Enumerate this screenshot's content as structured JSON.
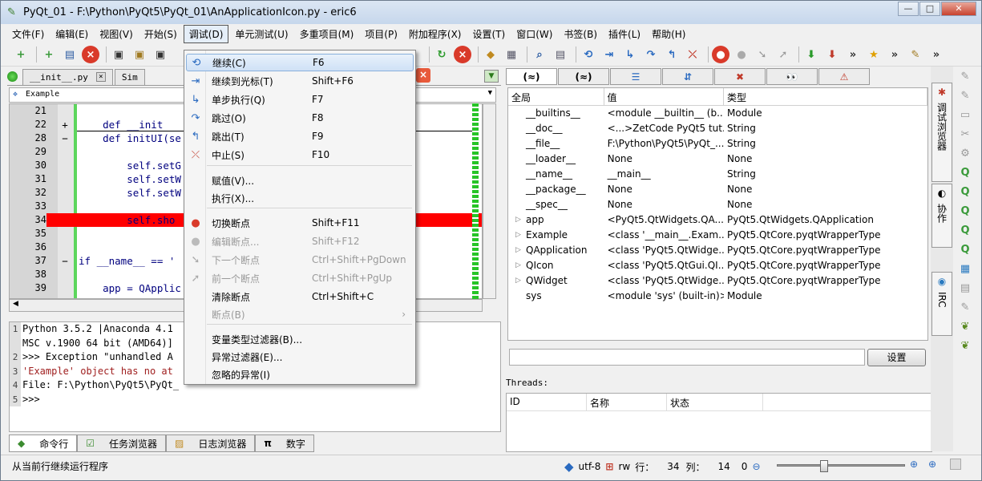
{
  "window": {
    "title": "PyQt_01 - F:\\Python\\PyQt5\\PyQt_01\\AnApplicationIcon.py - eric6",
    "min": "—",
    "max": "□",
    "close": "✕"
  },
  "menubar": [
    "文件(F)",
    "编辑(E)",
    "视图(V)",
    "开始(S)",
    "调试(D)",
    "单元测试(U)",
    "多重项目(M)",
    "项目(P)",
    "附加程序(X)",
    "设置(T)",
    "窗口(W)",
    "书签(B)",
    "插件(L)",
    "帮助(H)"
  ],
  "editor": {
    "tabs": [
      {
        "label": "__init__.py"
      },
      {
        "label": "Sim"
      }
    ],
    "class_combo": "Example",
    "lines": [
      {
        "n": "21",
        "fold": "",
        "text": ""
      },
      {
        "n": "22",
        "fold": "+",
        "text": "    def __init"
      },
      {
        "n": "28",
        "fold": "−",
        "text": "    def initUI(se"
      },
      {
        "n": "29",
        "fold": "",
        "text": ""
      },
      {
        "n": "30",
        "fold": "",
        "text": "        self.setG"
      },
      {
        "n": "31",
        "fold": "",
        "text": "        self.setW"
      },
      {
        "n": "32",
        "fold": "",
        "text": "        self.setW"
      },
      {
        "n": "33",
        "fold": "",
        "text": ""
      },
      {
        "n": "34",
        "fold": "",
        "text": "        self.sho"
      },
      {
        "n": "35",
        "fold": "",
        "text": ""
      },
      {
        "n": "36",
        "fold": "",
        "text": ""
      },
      {
        "n": "37",
        "fold": "−",
        "text": "if __name__ == '"
      },
      {
        "n": "38",
        "fold": "",
        "text": ""
      },
      {
        "n": "39",
        "fold": "",
        "text": "    app = QApplic"
      }
    ]
  },
  "shell": {
    "lines": [
      {
        "n": "1",
        "text": "Python 3.5.2 |Anaconda 4.1                      11:41:13) ["
      },
      {
        "n": "",
        "text": "MSC v.1900 64 bit (AMD64)]"
      },
      {
        "n": "2",
        "text": ">>> Exception \"unhandled A"
      },
      {
        "n": "3",
        "text": "'Example' object has no at"
      },
      {
        "n": "4",
        "text": "File: F:\\Python\\PyQt5\\PyQt_"
      },
      {
        "n": "5",
        "text": ">>>"
      }
    ]
  },
  "bottom_tabs": [
    "命令行",
    "任务浏览器",
    "日志浏览器",
    "数字"
  ],
  "debug_menu": {
    "items": [
      {
        "label": "继续(C)",
        "shortcut": "F6",
        "icon": "continue-icon",
        "glyph": "⟲",
        "disabled": false,
        "highlighted": true
      },
      {
        "label": "继续到光标(T)",
        "shortcut": "Shift+F6",
        "icon": "continue-to-cursor-icon",
        "glyph": "⇥",
        "disabled": false
      },
      {
        "label": "单步执行(Q)",
        "shortcut": "F7",
        "icon": "step-icon",
        "glyph": "↳",
        "disabled": false
      },
      {
        "label": "跳过(O)",
        "shortcut": "F8",
        "icon": "step-over-icon",
        "glyph": "↷",
        "disabled": false
      },
      {
        "label": "跳出(T)",
        "shortcut": "F9",
        "icon": "step-out-icon",
        "glyph": "↰",
        "disabled": false
      },
      {
        "label": "中止(S)",
        "shortcut": "F10",
        "icon": "stop-icon",
        "glyph": "⤫",
        "disabled": false
      },
      {
        "label": "赋值(V)...",
        "shortcut": "",
        "icon": "",
        "glyph": "",
        "disabled": false
      },
      {
        "label": "执行(X)...",
        "shortcut": "",
        "icon": "",
        "glyph": "",
        "disabled": false
      },
      {
        "label": "切换断点",
        "shortcut": "Shift+F11",
        "icon": "toggle-breakpoint-icon",
        "glyph": "●",
        "disabled": false
      },
      {
        "label": "编辑断点...",
        "shortcut": "Shift+F12",
        "icon": "edit-breakpoint-icon",
        "glyph": "●",
        "disabled": true
      },
      {
        "label": "下一个断点",
        "shortcut": "Ctrl+Shift+PgDown",
        "icon": "next-breakpoint-icon",
        "glyph": "➘",
        "disabled": true
      },
      {
        "label": "前一个断点",
        "shortcut": "Ctrl+Shift+PgUp",
        "icon": "previous-breakpoint-icon",
        "glyph": "➚",
        "disabled": true
      },
      {
        "label": "清除断点",
        "shortcut": "Ctrl+Shift+C",
        "icon": "",
        "glyph": "",
        "disabled": false
      },
      {
        "label": "断点(B)",
        "shortcut": "",
        "icon": "",
        "glyph": "",
        "disabled": true,
        "submenu": "›"
      },
      {
        "label": "变量类型过滤器(B)...",
        "shortcut": "",
        "icon": "",
        "glyph": "",
        "disabled": false
      },
      {
        "label": "异常过滤器(E)...",
        "shortcut": "",
        "icon": "",
        "glyph": "",
        "disabled": false
      },
      {
        "label": "忽略的异常(I)",
        "shortcut": "",
        "icon": "",
        "glyph": "",
        "disabled": false
      }
    ]
  },
  "variables": {
    "tabs": [
      "(≈)",
      "(≈)",
      "☰",
      "⇵",
      "✖",
      "👀",
      "⚠"
    ],
    "headers": [
      "全局",
      "值",
      "类型"
    ],
    "rows": [
      {
        "name": "__builtins__",
        "value": "<module __builtin__ (b...",
        "type": "Module",
        "exp": false
      },
      {
        "name": "__doc__",
        "value": "<...>ZetCode PyQt5 tut...",
        "type": "String",
        "exp": false
      },
      {
        "name": "__file__",
        "value": "F:\\Python\\PyQt5\\PyQt_...",
        "type": "String",
        "exp": false
      },
      {
        "name": "__loader__",
        "value": "None",
        "type": "None",
        "exp": false
      },
      {
        "name": "__name__",
        "value": "__main__",
        "type": "String",
        "exp": false
      },
      {
        "name": "__package__",
        "value": "None",
        "type": "None",
        "exp": false
      },
      {
        "name": "__spec__",
        "value": "None",
        "type": "None",
        "exp": false
      },
      {
        "name": "app",
        "value": "<PyQt5.QtWidgets.QA...",
        "type": "PyQt5.QtWidgets.QApplication",
        "exp": true
      },
      {
        "name": "Example",
        "value": "<class '__main__.Exam...",
        "type": "PyQt5.QtCore.pyqtWrapperType",
        "exp": true
      },
      {
        "name": "QApplication",
        "value": "<class 'PyQt5.QtWidge...",
        "type": "PyQt5.QtCore.pyqtWrapperType",
        "exp": true
      },
      {
        "name": "QIcon",
        "value": "<class 'PyQt5.QtGui.QI...",
        "type": "PyQt5.QtCore.pyqtWrapperType",
        "exp": true
      },
      {
        "name": "QWidget",
        "value": "<class 'PyQt5.QtWidge...",
        "type": "PyQt5.QtCore.pyqtWrapperType",
        "exp": true
      },
      {
        "name": "sys",
        "value": "<module 'sys' (built-in)>",
        "type": "Module",
        "exp": false
      }
    ],
    "settings_button": "设置"
  },
  "threads": {
    "label": "Threads:",
    "headers": [
      "ID",
      "名称",
      "状态"
    ]
  },
  "side_tabs": [
    "调试浏览器",
    "协作",
    "IRC"
  ],
  "status": {
    "message": "从当前行继续运行程序",
    "encoding": "utf-8",
    "mode": "rw",
    "line_label": "行：",
    "line": "34",
    "col_label": "列：",
    "col": "14",
    "zoom": "0",
    "zoom_slider_level": 0.35
  },
  "colors": {
    "breakpoint_line": "#ff0000",
    "coverage_green": "#27c427",
    "menu_highlight": "#cfe1f6"
  }
}
